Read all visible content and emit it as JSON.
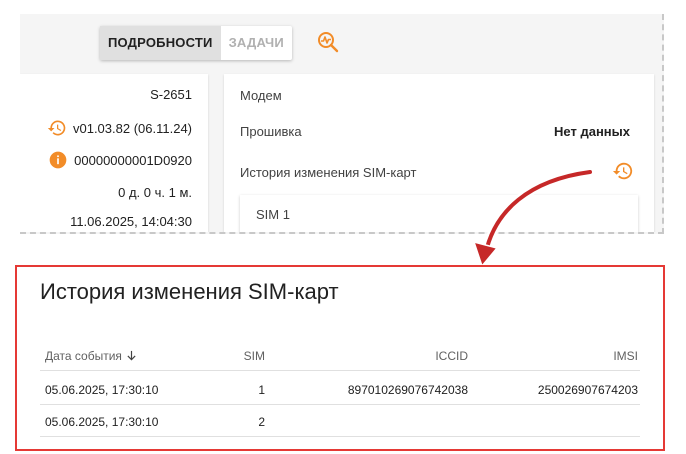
{
  "tabs": {
    "details": "ПОДРОБНОСТИ",
    "tasks": "ЗАДАЧИ"
  },
  "device": {
    "id": "S-2651",
    "firmware_version": "v01.03.82 (06.11.24)",
    "serial": "00000000001D0920",
    "uptime": "0 д. 0 ч. 1 м.",
    "datetime": "11.06.2025, 14:04:30"
  },
  "modem": {
    "title": "Модем",
    "firmware_label": "Прошивка",
    "firmware_value": "Нет данных",
    "history_label": "История изменения SIM-карт",
    "sim_panel": "SIM 1"
  },
  "dialog": {
    "title": "История изменения SIM-карт",
    "columns": {
      "date": "Дата события",
      "sim": "SIM",
      "iccid": "ICCID",
      "imsi": "IMSI"
    },
    "rows": [
      {
        "date": "05.06.2025, 17:30:10",
        "sim": "1",
        "iccid": "897010269076742038",
        "imsi": "250026907674203"
      },
      {
        "date": "05.06.2025, 17:30:10",
        "sim": "2",
        "iccid": "",
        "imsi": ""
      }
    ]
  },
  "colors": {
    "accent_orange": "#f28c28",
    "highlight_red": "#e53935",
    "arrow_red": "#c62828"
  },
  "icons": {
    "history": "history-icon",
    "info": "info-icon",
    "analyze": "analytics-search-icon",
    "sort": "arrow-down-icon"
  }
}
